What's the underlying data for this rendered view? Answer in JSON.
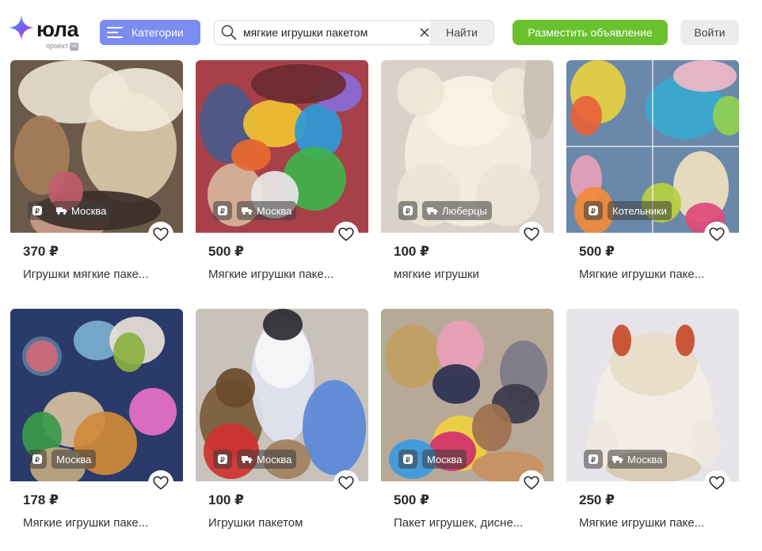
{
  "header": {
    "logo_text": "юла",
    "logo_sub": "проект",
    "vk": "VK",
    "categories_label": "Категории",
    "search_value": "мягкие игрушки пакетом",
    "search_button": "Найти",
    "post_button": "Разместить объявление",
    "login_button": "Войти"
  },
  "colors": {
    "accent_blue": "#7b8df0",
    "accent_green": "#6ac12e"
  },
  "listings": [
    {
      "price": "370 ₽",
      "title": "Игрушки мягкие паке...",
      "location": "Москва",
      "delivery": true
    },
    {
      "price": "500 ₽",
      "title": "Мягкие игрушки паке...",
      "location": "Москва",
      "delivery": true
    },
    {
      "price": "100 ₽",
      "title": "мягкие игрушки",
      "location": "Люберцы",
      "delivery": true
    },
    {
      "price": "500 ₽",
      "title": "Мягкие игрушки паке...",
      "location": "Котельники",
      "delivery": false
    },
    {
      "price": "178 ₽",
      "title": "Мягкие игрушки паке...",
      "location": "Москва",
      "delivery": false
    },
    {
      "price": "100 ₽",
      "title": "Игрушки пакетом",
      "location": "Москва",
      "delivery": true
    },
    {
      "price": "500 ₽",
      "title": "Пакет игрушек, дисне...",
      "location": "Москва",
      "delivery": false
    },
    {
      "price": "250 ₽",
      "title": "Мягкие игрушки паке...",
      "location": "Москва",
      "delivery": true
    }
  ]
}
